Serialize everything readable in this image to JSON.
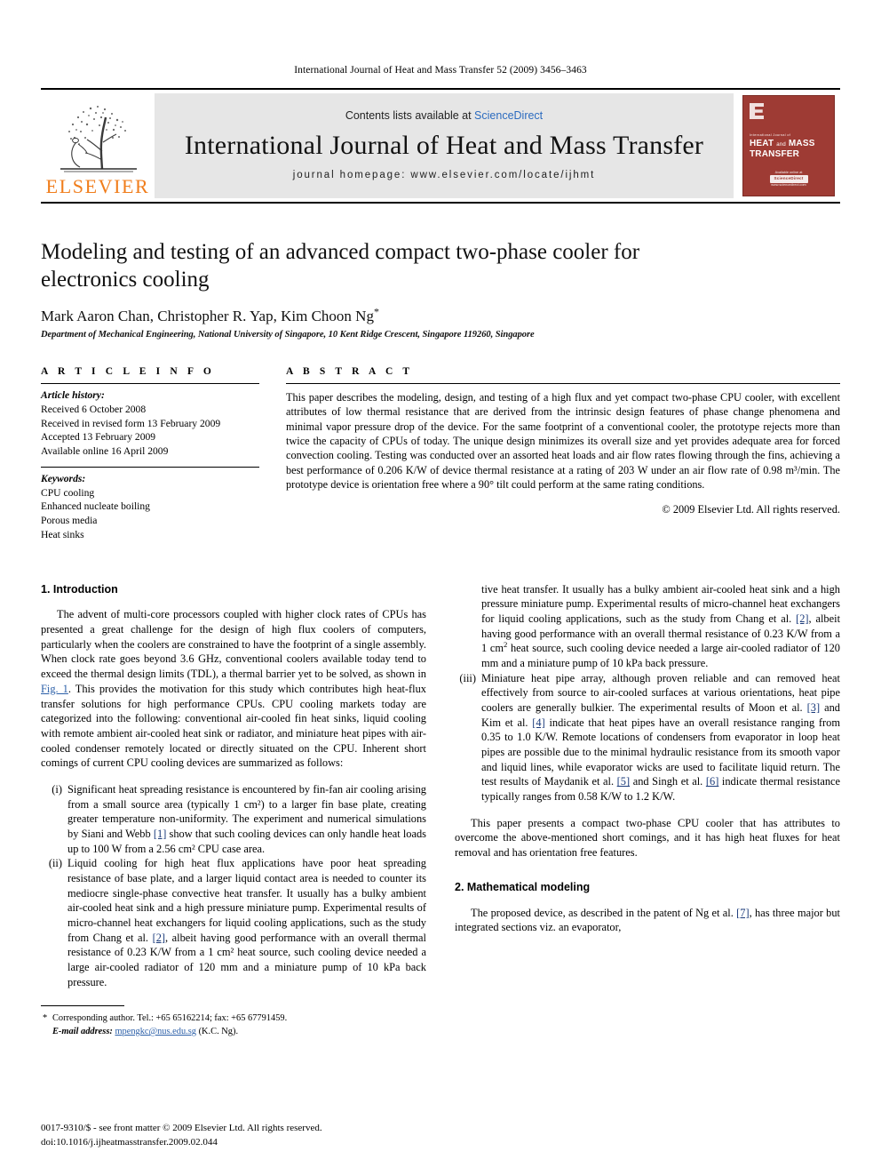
{
  "running_head": "International Journal of Heat and Mass Transfer 52 (2009) 3456–3463",
  "masthead": {
    "contents_prefix": "Contents lists available at ",
    "sciencedirect": "ScienceDirect",
    "journal_title": "International Journal of Heat and Mass Transfer",
    "homepage": "journal homepage: www.elsevier.com/locate/ijhmt",
    "publisher_wordmark": "ELSEVIER",
    "cover": {
      "superline": "International Journal of",
      "line1": "HEAT",
      "and": "and",
      "line2": "MASS",
      "line3": "TRANSFER",
      "foot_label": "Available online at",
      "foot_badge": "ScienceDirect",
      "foot_url": "www.sciencedirect.com",
      "color": "#9e3b34"
    }
  },
  "article": {
    "title": "Modeling and testing of an advanced compact two-phase cooler for electronics cooling",
    "authors": "Mark Aaron Chan, Christopher R. Yap, Kim Choon Ng",
    "corresponding_marker": "*",
    "affiliation": "Department of Mechanical Engineering, National University of Singapore, 10 Kent Ridge Crescent, Singapore 119260, Singapore"
  },
  "article_info": {
    "heading": "A R T I C L E   I N F O",
    "history_label": "Article history:",
    "history": [
      "Received 6 October 2008",
      "Received in revised form 13 February 2009",
      "Accepted 13 February 2009",
      "Available online 16 April 2009"
    ],
    "keywords_label": "Keywords:",
    "keywords": [
      "CPU cooling",
      "Enhanced nucleate boiling",
      "Porous media",
      "Heat sinks"
    ]
  },
  "abstract": {
    "heading": "A B S T R A C T",
    "text": "This paper describes the modeling, design, and testing of a high flux and yet compact two-phase CPU cooler, with excellent attributes of low thermal resistance that are derived from the intrinsic design features of phase change phenomena and minimal vapor pressure drop of the device. For the same footprint of a conventional cooler, the prototype rejects more than twice the capacity of CPUs of today. The unique design minimizes its overall size and yet provides adequate area for forced convection cooling. Testing was conducted over an assorted heat loads and air flow rates flowing through the fins, achieving a best performance of 0.206 K/W of device thermal resistance at a rating of 203 W under an air flow rate of 0.98 m³/min. The prototype device is orientation free where a 90° tilt could perform at the same rating conditions.",
    "copyright": "© 2009 Elsevier Ltd. All rights reserved."
  },
  "sections": {
    "intro_heading": "1. Introduction",
    "intro_p1_a": "The advent of multi-core processors coupled with higher clock rates of CPUs has presented a great challenge for the design of high flux coolers of computers, particularly when the coolers are constrained to have the footprint of a single assembly. When clock rate goes beyond 3.6 GHz, conventional coolers available today tend to exceed the thermal design limits (TDL), a thermal barrier yet to be solved, as shown in ",
    "intro_fig_ref": "Fig. 1",
    "intro_p1_b": ". This provides the motivation for this study which contributes high heat-flux transfer solutions for high performance CPUs. CPU cooling markets today are categorized into the following: conventional air-cooled fin heat sinks, liquid cooling with remote ambient air-cooled heat sink or radiator, and miniature heat pipes with air-cooled condenser remotely located or directly situated on the CPU. Inherent short comings of current CPU cooling devices are summarized as follows:",
    "list": [
      {
        "marker": "(i)",
        "text_a": "Significant heat spreading resistance is encountered by fin-fan air cooling arising from a small source area (typically 1 cm²) to a larger fin base plate, creating greater temperature non-uniformity. The experiment and numerical simulations by Siani and Webb ",
        "ref": "[1]",
        "text_b": " show that such cooling devices can only handle heat loads up to 100 W from a 2.56 cm² CPU case area."
      },
      {
        "marker": "(ii)",
        "text_a": "Liquid cooling for high heat flux applications have poor heat spreading resistance of base plate, and a larger liquid contact area is needed to counter its mediocre single-phase convective heat transfer. It usually has a bulky ambient air-cooled heat sink and a high pressure miniature pump. Experimental results of micro-channel heat exchangers for liquid cooling applications, such as the study from Chang et al. ",
        "ref": "[2]",
        "text_b": ", albeit having good performance with an overall thermal resistance of 0.23 K/W from a 1 cm² heat source, such cooling device needed a large air-cooled radiator of 120 mm and a miniature pump of 10 kPa back pressure."
      },
      {
        "marker": "(iii)",
        "text_a": "Miniature heat pipe array, although proven reliable and can removed heat effectively from source to air-cooled surfaces at various orientations, heat pipe coolers are generally bulkier. The experimental results of Moon et al. ",
        "ref": "[3]",
        "text_mid": " and Kim et al. ",
        "ref2": "[4]",
        "text_b": " indicate that heat pipes have an overall resistance ranging from 0.35 to 1.0 K/W. Remote locations of condensers from evaporator in loop heat pipes are possible due to the minimal hydraulic resistance from its smooth vapor and liquid lines, while evaporator wicks are used to facilitate liquid return. The test results of Maydanik et al. ",
        "ref3": "[5]",
        "text_c": " and Singh et al. ",
        "ref4": "[6]",
        "text_d": " indicate thermal resistance typically ranges from 0.58 K/W to 1.2 K/W."
      }
    ],
    "intro_p2": "This paper presents a compact two-phase CPU cooler that has attributes to overcome the above-mentioned short comings, and it has high heat fluxes for heat removal and has orientation free features.",
    "math_heading": "2. Mathematical modeling",
    "math_p1_a": "The proposed device, as described in the patent of Ng et al. ",
    "math_ref": "[7]",
    "math_p1_b": ", has three major but integrated sections viz. an evaporator,"
  },
  "footnote": {
    "star": "*",
    "corresponding": "Corresponding author. Tel.: +65 65162214; fax: +65 67791459.",
    "email_label": "E-mail address:",
    "email": "mpengkc@nus.edu.sg",
    "email_owner": "(K.C. Ng)."
  },
  "page_footer": {
    "issn_line": "0017-9310/$ - see front matter © 2009 Elsevier Ltd. All rights reserved.",
    "doi_line": "doi:10.1016/j.ijheatmasstransfer.2009.02.044"
  }
}
